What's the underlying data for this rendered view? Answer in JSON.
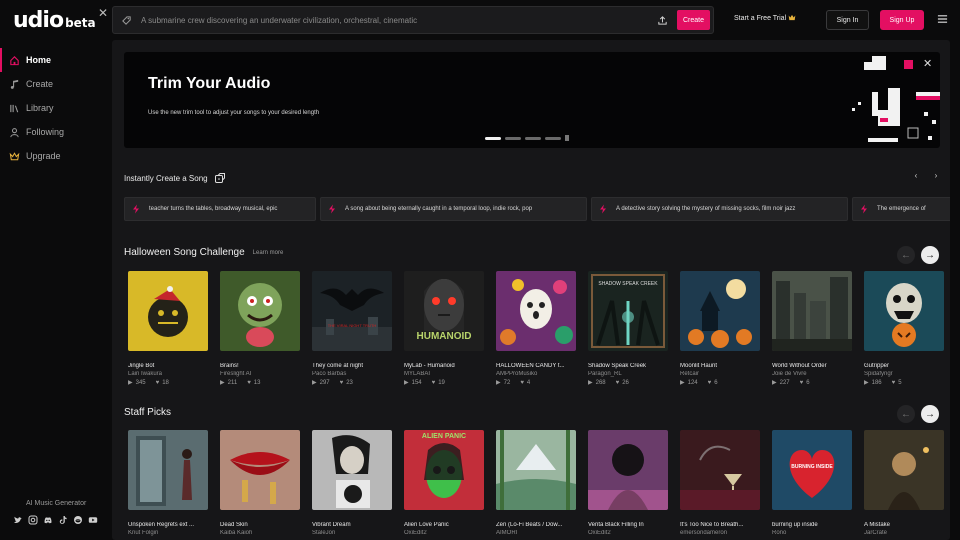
{
  "brand": {
    "name": "udio",
    "suffix": "beta"
  },
  "sidebar": {
    "items": [
      {
        "label": "Home",
        "icon": "home-icon",
        "active": true
      },
      {
        "label": "Create",
        "icon": "music-note-icon",
        "active": false
      },
      {
        "label": "Library",
        "icon": "library-icon",
        "active": false
      },
      {
        "label": "Following",
        "icon": "user-icon",
        "active": false
      },
      {
        "label": "Upgrade",
        "icon": "crown-icon",
        "active": false
      }
    ],
    "footer_text": "AI Music Generator",
    "socials": [
      "twitter-icon",
      "instagram-icon",
      "discord-icon",
      "tiktok-icon",
      "reddit-icon",
      "youtube-icon"
    ]
  },
  "topbar": {
    "search_placeholder": "A submarine crew discovering an underwater civilization, orchestral, cinematic",
    "create_label": "Create",
    "trial_label": "Start a Free Trial",
    "signin_label": "Sign In",
    "signup_label": "Sign Up"
  },
  "banner": {
    "title": "Trim Your Audio",
    "subtitle": "Use the new trim tool to adjust your songs to your desired length",
    "slide_index": 1,
    "slide_count": 5
  },
  "instant": {
    "title": "Instantly Create a Song",
    "prompts": [
      "teacher turns the tables, broadway musical, epic",
      "A song about being eternally caught in a temporal loop, indie rock, pop",
      "A detective story solving the mystery of missing socks, film noir jazz",
      "The emergence of"
    ]
  },
  "halloween": {
    "title": "Halloween Song Challenge",
    "learn_more": "Learn more",
    "songs": [
      {
        "title": "Jingle Bot",
        "artist": "Lain Iwakura",
        "plays": "345",
        "likes": "18"
      },
      {
        "title": "Brains!",
        "artist": "Fireslight AI",
        "plays": "211",
        "likes": "13"
      },
      {
        "title": "They come at night",
        "artist": "Paco Barbas",
        "plays": "297",
        "likes": "23"
      },
      {
        "title": "MyLab - Humanoid",
        "artist": "MYLABAI",
        "plays": "154",
        "likes": "19"
      },
      {
        "title": "HALLOWEEN CANDY t...",
        "artist": "AMPProMusiko",
        "plays": "72",
        "likes": "4"
      },
      {
        "title": "Shadow Speak Creek",
        "artist": "Paragon_RL",
        "plays": "268",
        "likes": "26"
      },
      {
        "title": "Moonlit Haunt",
        "artist": "Retcair",
        "plays": "124",
        "likes": "6"
      },
      {
        "title": "World Without Order",
        "artist": "Joie de Vivre",
        "plays": "227",
        "likes": "6"
      },
      {
        "title": "Gutripper",
        "artist": "Spidafyngr",
        "plays": "186",
        "likes": "5"
      }
    ]
  },
  "staff": {
    "title": "Staff Picks",
    "songs": [
      {
        "title": "Unspoken Regrets ext ...",
        "artist": "Knut Folgin"
      },
      {
        "title": "Dead Skin",
        "artist": "Kaiba Kaioh"
      },
      {
        "title": "Vibrant Dream",
        "artist": "StaleJon"
      },
      {
        "title": "Alien Love Panic",
        "artist": "OxiEdit2"
      },
      {
        "title": "Zen (Lo-Fi Beats / Dow...",
        "artist": "AIMORI"
      },
      {
        "title": "Venta Black Filling In",
        "artist": "OxiEdit2"
      },
      {
        "title": "It's Too Nice to Breath...",
        "artist": "emersondameron"
      },
      {
        "title": "burning up inside",
        "artist": "Rono"
      },
      {
        "title": "A Mistake",
        "artist": "JarCrate"
      }
    ]
  },
  "cover_text": {
    "humanoid": "HUMANOID",
    "shadow": "SHADOW SPEAK CREEK",
    "alien": "ALIEN PANIC",
    "burning": "BURNING INSIDE",
    "night": "THE VIRAL NIGHT TRUTH"
  },
  "colors": {
    "accent": "#e30f62",
    "background": "#0b0b0c",
    "panel": "#161618"
  }
}
